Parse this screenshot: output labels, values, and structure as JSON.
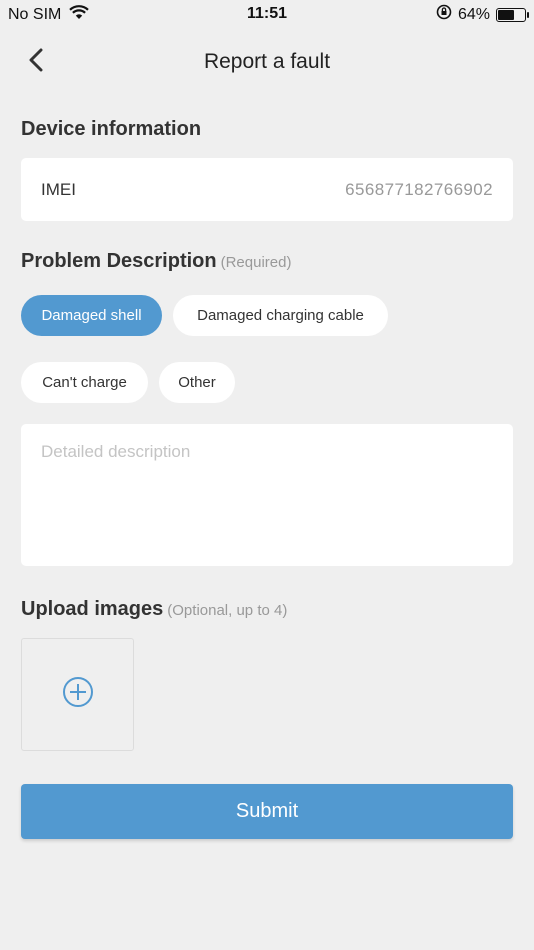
{
  "status_bar": {
    "carrier": "No SIM",
    "time": "11:51",
    "battery_percent_label": "64%",
    "battery_level": 0.64
  },
  "nav": {
    "title": "Report a fault"
  },
  "device_info": {
    "section_title": "Device information",
    "imei_label": "IMEI",
    "imei_value": "656877182766902"
  },
  "problem": {
    "section_title": "Problem Description",
    "section_hint": "(Required)",
    "chips": [
      {
        "label": "Damaged shell",
        "selected": true
      },
      {
        "label": "Damaged charging cable",
        "selected": false
      },
      {
        "label": "Can't charge",
        "selected": false
      },
      {
        "label": "Other",
        "selected": false
      }
    ],
    "description_placeholder": "Detailed description",
    "description_value": ""
  },
  "upload": {
    "section_title": "Upload images",
    "section_hint": "(Optional, up to 4)"
  },
  "submit_label": "Submit",
  "colors": {
    "accent": "#5299d0",
    "background": "#efefef",
    "card": "#ffffff"
  }
}
